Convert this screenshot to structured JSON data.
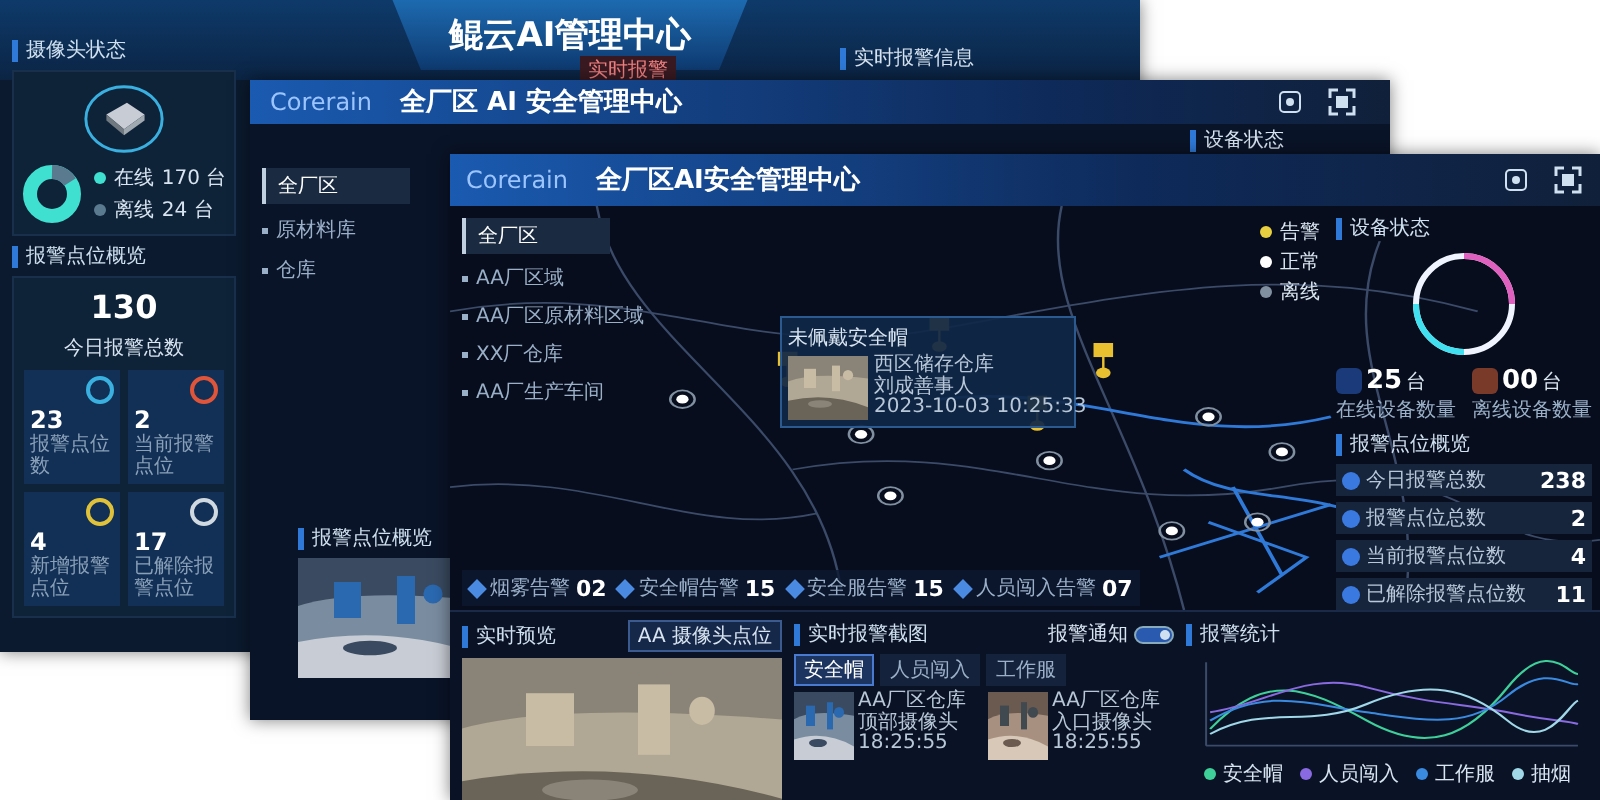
{
  "back_window": {
    "title": "鲲云AI管理中心",
    "camera_panel": {
      "title": "摄像头状态",
      "legend": [
        {
          "label": "在线",
          "value": "170 台",
          "color": "#3fe0d0"
        },
        {
          "label": "离线",
          "value": "24 台",
          "color": "#5a7a90"
        }
      ]
    },
    "alarm_panel": {
      "title": "报警点位概览",
      "total": "130",
      "total_label": "今日报警总数",
      "tiles": [
        {
          "value": "23",
          "label": "报警点位数",
          "color": "#3ab0e0"
        },
        {
          "value": "2",
          "label": "当前报警点位",
          "color": "#e0553a"
        },
        {
          "value": "4",
          "label": "新增报警点位",
          "color": "#e0c23a"
        },
        {
          "value": "17",
          "label": "已解除报警点位",
          "color": "#d0d8e0"
        }
      ]
    },
    "realtime_alarm": {
      "title": "实时报警信息",
      "badge": "实时报警"
    }
  },
  "middle_window": {
    "brand": "Corerain",
    "title": "全厂区 AI 安全管理中心",
    "zone": "全厂区",
    "zones": [
      "原材料库",
      "仓库"
    ],
    "device_title": "设备状态",
    "overview_title": "报警点位概览"
  },
  "front_window": {
    "brand": "Corerain",
    "title": "全厂区AI安全管理中心",
    "zone": "全厂区",
    "zones": [
      "AA厂区域",
      "AA厂区原材料区域",
      "XX厂仓库",
      "AA厂生产车间"
    ],
    "legend": [
      {
        "label": "告警",
        "color": "#e8d040"
      },
      {
        "label": "正常",
        "color": "#ffffff"
      },
      {
        "label": "离线",
        "color": "#8090a0"
      }
    ],
    "popup": {
      "title": "未佩戴安全帽",
      "lines": [
        "西区储存仓库",
        "刘成善事人",
        "2023-10-03 10:25:33"
      ]
    },
    "stats": [
      {
        "label": "烟雾告警",
        "value": "02"
      },
      {
        "label": "安全帽告警",
        "value": "15"
      },
      {
        "label": "安全服告警",
        "value": "15"
      },
      {
        "label": "人员闯入告警",
        "value": "07"
      }
    ],
    "device_status": {
      "title": "设备状态",
      "online": {
        "value": "25",
        "unit": "台",
        "label": "在线设备数量"
      },
      "offline": {
        "value": "00",
        "unit": "台",
        "label": "离线设备数量"
      }
    },
    "alarm_overview": {
      "title": "报警点位概览",
      "rows": [
        {
          "label": "今日报警总数",
          "value": "238"
        },
        {
          "label": "报警点位总数",
          "value": "2"
        },
        {
          "label": "当前报警点位数",
          "value": "4"
        },
        {
          "label": "已解除报警点位数",
          "value": "11"
        }
      ]
    },
    "preview": {
      "title": "实时预览",
      "select": "AA 摄像头点位"
    },
    "snapshots": {
      "title": "实时报警截图",
      "toggle_label": "报警通知",
      "tabs": [
        {
          "label": "安全帽",
          "selected": true
        },
        {
          "label": "人员闯入",
          "selected": false
        },
        {
          "label": "工作服",
          "selected": false
        }
      ],
      "toggle_on": true,
      "items": [
        {
          "lines": [
            "AA厂区仓库",
            "顶部摄像头",
            "18:25:55"
          ]
        },
        {
          "lines": [
            "AA厂区仓库",
            "入口摄像头",
            "18:25:55"
          ]
        }
      ]
    },
    "chart": {
      "title": "报警统计",
      "legend": [
        {
          "name": "安全帽",
          "color": "#3fd09a"
        },
        {
          "name": "人员闯入",
          "color": "#8a6ae0"
        },
        {
          "name": "工作服",
          "color": "#3a8ae0"
        },
        {
          "name": "抽烟",
          "color": "#a0d8e8"
        }
      ]
    }
  }
}
